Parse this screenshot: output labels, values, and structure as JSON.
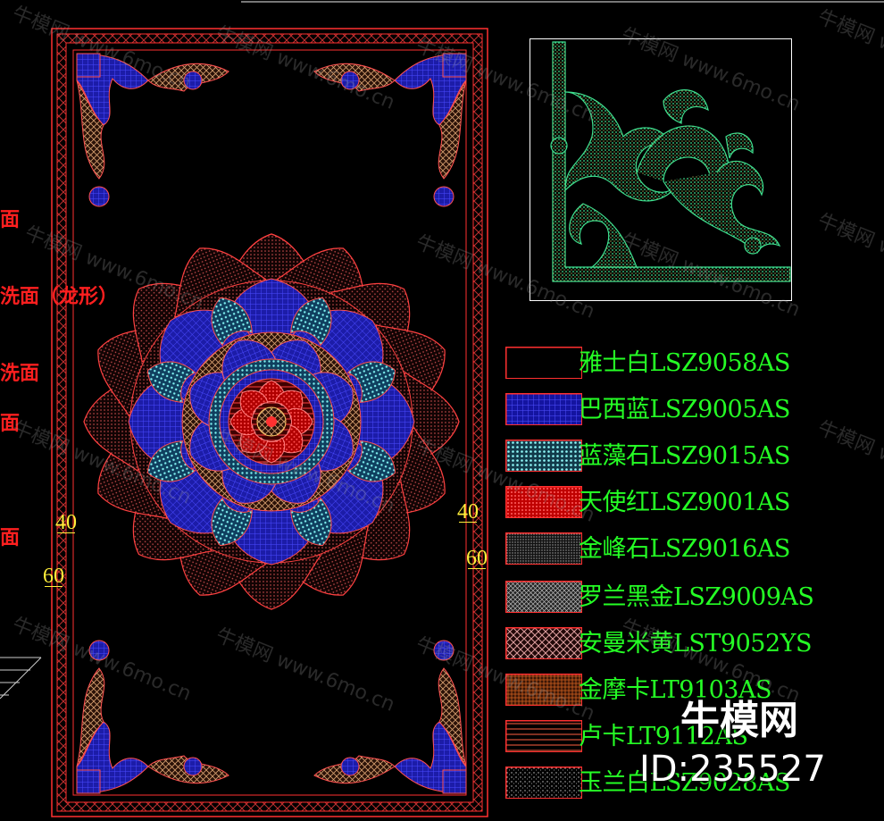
{
  "side_labels": [
    "面",
    "洗面（龙形）",
    "洗面",
    "面",
    "面"
  ],
  "dimensions": {
    "left_top": "40",
    "left_bottom": "60",
    "right_top": "40",
    "right_bottom": "60"
  },
  "legend": [
    {
      "label": "雅士白LSZ9058AS",
      "pattern": "plain",
      "color": "#000000"
    },
    {
      "label": "巴西蓝LSZ9005AS",
      "pattern": "blue-grid",
      "color": "#2a2ae0"
    },
    {
      "label": "蓝藻石LSZ9015AS",
      "pattern": "cyan-dots",
      "color": "#5fd0d0"
    },
    {
      "label": "天使红LSZ9001AS",
      "pattern": "red-dots",
      "color": "#ff2020"
    },
    {
      "label": "金峰石LSZ9016AS",
      "pattern": "fine-dots",
      "color": "#aaaaaa"
    },
    {
      "label": "罗兰黑金LSZ9009AS",
      "pattern": "gray-grid",
      "color": "#bbbbbb"
    },
    {
      "label": "安曼米黄LST9052YS",
      "pattern": "cross-hatch",
      "color": "#e0a0a0"
    },
    {
      "label": "金摩卡LT9103AS",
      "pattern": "orange-hatch",
      "color": "#d06020"
    },
    {
      "label": "卢卡LT9112AS",
      "pattern": "lines",
      "color": "#ff6040"
    },
    {
      "label": "玉兰白LSZ9028AS",
      "pattern": "sparse-dots",
      "color": "#cccccc"
    }
  ],
  "watermark_text": "牛模网 www.6mo.cn",
  "brand": {
    "name": "牛模网",
    "id": "ID:235527"
  }
}
